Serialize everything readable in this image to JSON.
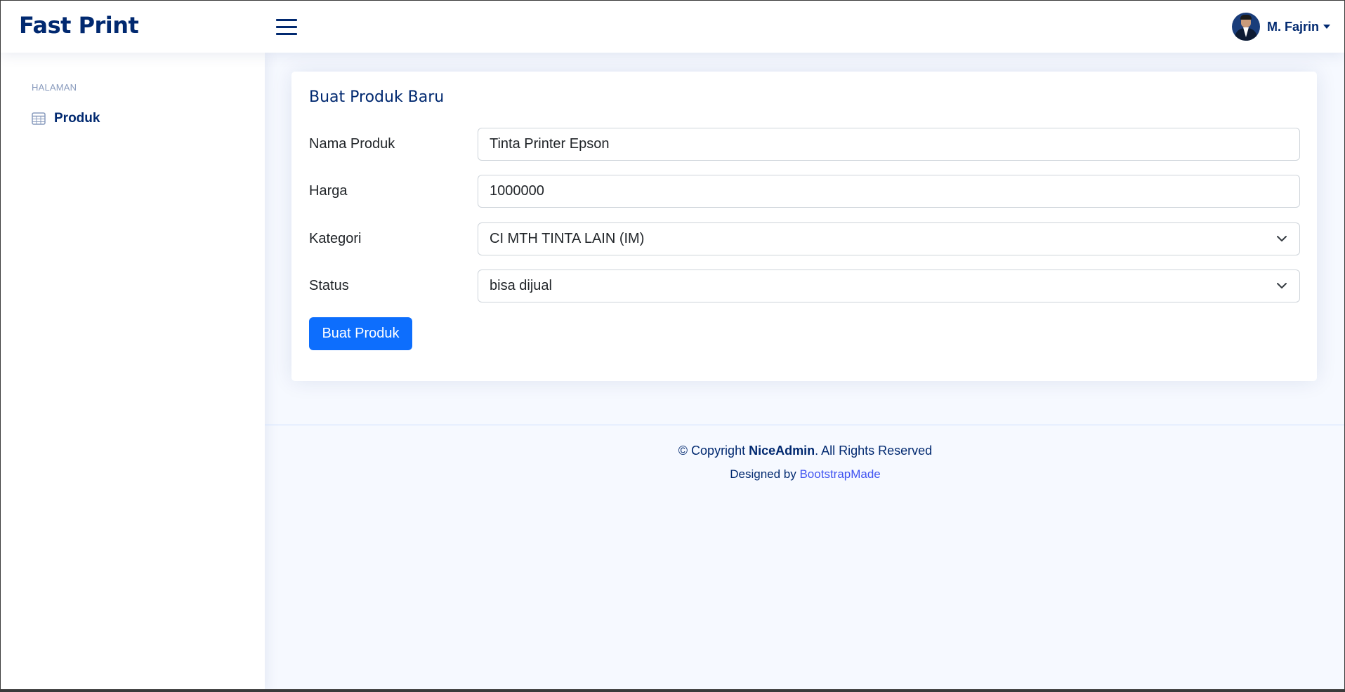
{
  "header": {
    "logo": "Fast Print",
    "user_name": "M. Fajrin"
  },
  "sidebar": {
    "heading": "HALAMAN",
    "items": [
      {
        "label": "Produk",
        "icon": "table-icon"
      }
    ]
  },
  "form": {
    "title": "Buat Produk Baru",
    "fields": {
      "nama_produk": {
        "label": "Nama Produk",
        "value": "Tinta Printer Epson"
      },
      "harga": {
        "label": "Harga",
        "value": "1000000"
      },
      "kategori": {
        "label": "Kategori",
        "selected": "CI MTH TINTA LAIN (IM)"
      },
      "status": {
        "label": "Status",
        "selected": "bisa dijual"
      }
    },
    "submit_label": "Buat Produk"
  },
  "footer": {
    "copyright_prefix": "© Copyright ",
    "brand": "NiceAdmin",
    "copyright_suffix": ". All Rights Reserved",
    "designed_by": "Designed by ",
    "designer_link": "BootstrapMade"
  },
  "colors": {
    "primary": "#012970",
    "accent": "#0d6efd",
    "link": "#4154f1",
    "background": "#f6f9ff"
  }
}
